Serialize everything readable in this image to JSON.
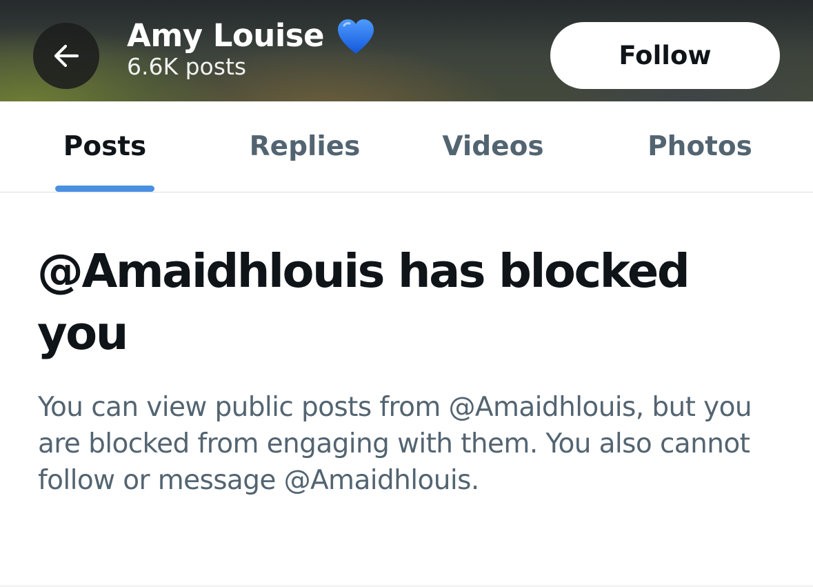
{
  "header": {
    "name": "Amy Louise",
    "name_emoji": "blue-heart-icon",
    "posts_count": "6.6K posts",
    "follow_label": "Follow",
    "back_icon": "arrow-left-icon"
  },
  "tabs": [
    {
      "label": "Posts",
      "active": true
    },
    {
      "label": "Replies",
      "active": false
    },
    {
      "label": "Videos",
      "active": false
    },
    {
      "label": "Photos",
      "active": false
    }
  ],
  "blocked": {
    "title": "@Amaidhlouis has blocked you",
    "description": "You can view public posts from @Amaidhlouis, but you are blocked from engaging with them. You also cannot follow or message @Amaidhlouis."
  },
  "colors": {
    "tab_indicator": "#4a90e2",
    "heart": "#1d6ff2",
    "primary_text": "#0f1419",
    "secondary_text": "#536471"
  }
}
